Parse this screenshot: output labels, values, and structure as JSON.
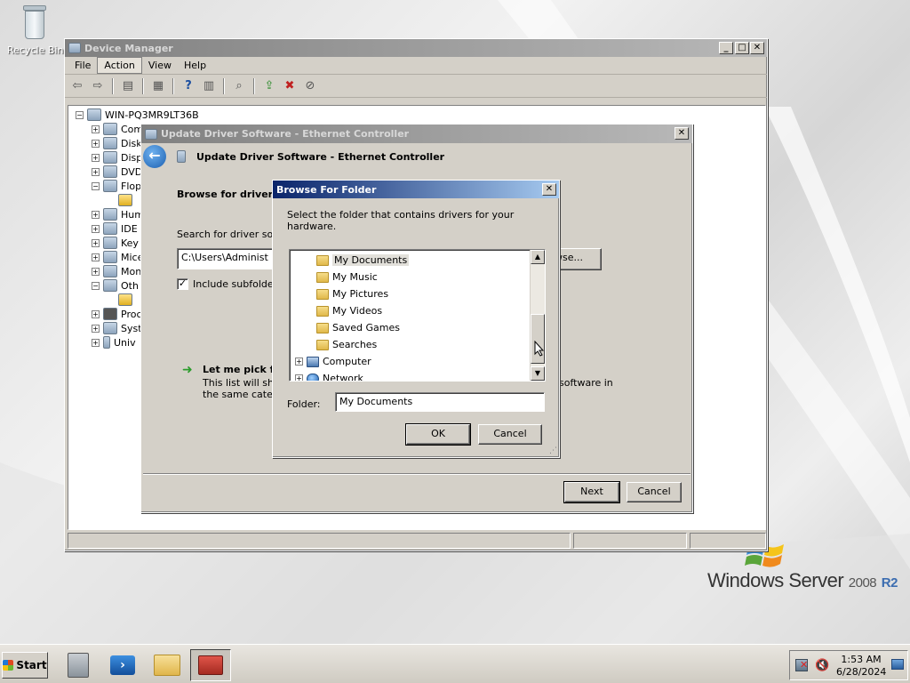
{
  "desktop": {
    "recycle_bin_label": "Recycle Bin",
    "brand": {
      "name": "Windows Server",
      "version": "2008",
      "edition": "R2"
    }
  },
  "device_manager": {
    "title": "Device Manager",
    "menu": [
      "File",
      "Action",
      "View",
      "Help"
    ],
    "selected_menu": "Action",
    "toolbar_icons": [
      "back-icon",
      "forward-icon",
      "show-hide-icon",
      "properties-icon",
      "help-icon",
      "details-icon",
      "scan-hardware-icon",
      "update-driver-icon",
      "uninstall-icon",
      "disable-icon"
    ],
    "root_node": "WIN-PQ3MR9LT36B",
    "tree_items": [
      "Com",
      "Disk",
      "Disp",
      "DVD",
      "Flop",
      "Hum",
      "IDE",
      "Key",
      "Mice",
      "Mon",
      "Oth",
      "Proc",
      "Syst",
      "Univ"
    ]
  },
  "update_driver": {
    "title": "Update Driver Software - Ethernet Controller",
    "header": "Update Driver Software - Ethernet Controller",
    "heading": "Browse for driver s",
    "search_label": "Search for driver sof",
    "path_value": "C:\\Users\\Administ",
    "browse_label": "wse...",
    "include_subfolders": "Include subfolde",
    "include_checked": true,
    "pick_title": "Let me pick fr",
    "pick_desc_1": "This list will show",
    "pick_desc_1_end": "software in",
    "pick_desc_2": "the same catego",
    "next_label": "Next",
    "cancel_label": "Cancel"
  },
  "browse_folder": {
    "title": "Browse For Folder",
    "instruction": "Select the folder that contains drivers for your hardware.",
    "items": [
      {
        "label": "My Documents",
        "icon": "folder",
        "selected": true
      },
      {
        "label": "My Music",
        "icon": "folder"
      },
      {
        "label": "My Pictures",
        "icon": "folder"
      },
      {
        "label": "My Videos",
        "icon": "folder"
      },
      {
        "label": "Saved Games",
        "icon": "folder"
      },
      {
        "label": "Searches",
        "icon": "folder"
      },
      {
        "label": "Computer",
        "icon": "computer",
        "expandable": true
      },
      {
        "label": "Network",
        "icon": "network",
        "expandable": true
      }
    ],
    "folder_label": "Folder:",
    "folder_value": "My Documents",
    "ok_label": "OK",
    "cancel_label": "Cancel"
  },
  "taskbar": {
    "start_label": "Start",
    "apps": [
      "server-manager-icon",
      "powershell-icon",
      "explorer-icon",
      "device-manager-icon"
    ],
    "active_app": "device-manager-icon",
    "time": "1:53 AM",
    "date": "6/28/2024"
  }
}
